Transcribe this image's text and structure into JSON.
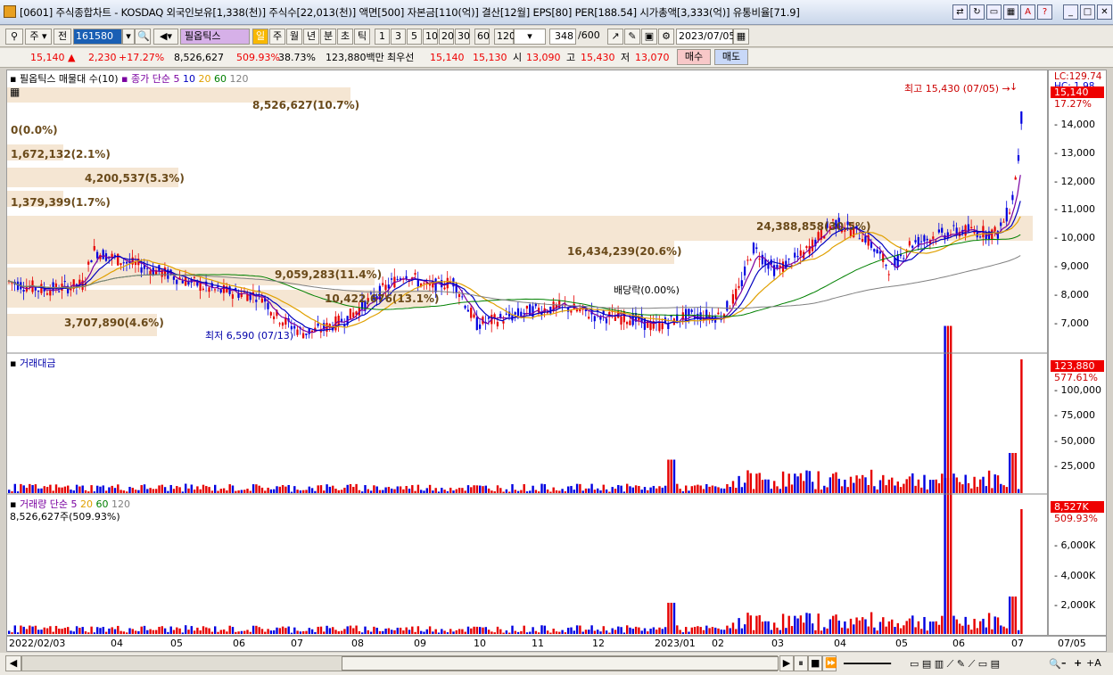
{
  "window": {
    "title": "[0601] 주식종합차트 - KOSDAQ 외국인보유[1,338(천)] 주식수[22,013(천)] 액면[500] 자본금[110(억)] 결산[12월] EPS[80] PER[188.54] 시가총액[3,333(억)] 유통비율[71.9]"
  },
  "toolbar": {
    "market": "주",
    "prev_btn": "전",
    "code": "161580",
    "stock_name": "필옵틱스",
    "periods": [
      "일",
      "주",
      "월",
      "년",
      "분",
      "초",
      "틱"
    ],
    "intervals": [
      "1",
      "3",
      "5",
      "10",
      "20",
      "30",
      "60",
      "120"
    ],
    "count": "348",
    "count_max": "/600",
    "date": "2023/07/05"
  },
  "quote": {
    "price": "15,140",
    "change": "2,230",
    "change_pct": "+17.27%",
    "volume": "8,526,627",
    "volume_ratio": "509.93%",
    "turnover": "38.73%",
    "amount": "123,880백만",
    "best_bid_label": "최우선",
    "best_ask": "15,140",
    "best_bid": "15,130",
    "open_label": "시",
    "open": "13,090",
    "high_label": "고",
    "high": "15,430",
    "low_label": "저",
    "low": "13,070",
    "buy_btn": "매수",
    "sell_btn": "매도"
  },
  "price_panel": {
    "legend_main": "필옵틱스 매물대 수(10)",
    "legend_ma": "종가 단순 5",
    "ma_periods": [
      "10",
      "20",
      "60",
      "120"
    ],
    "max_annot": "최고 15,430 (07/05) →",
    "min_annot": "최저 6,590 (07/13)",
    "dividend_annot": "배당락(0.00%)",
    "lc": "LC:129.74",
    "hc": "HC: 1.98",
    "current_price": "15,140",
    "current_pct": "17.27%",
    "yticks": [
      "14,000",
      "13,000",
      "12,000",
      "11,000",
      "10,000",
      "9,000",
      "8,000",
      "7,000"
    ],
    "volume_profile": [
      {
        "label": "8,526,627(10.7%)"
      },
      {
        "label": "0(0.0%)"
      },
      {
        "label": "1,672,132(2.1%)"
      },
      {
        "label": "4,200,537(5.3%)"
      },
      {
        "label": "1,379,399(1.7%)"
      },
      {
        "label": "24,388,858(30.5%)"
      },
      {
        "label": "16,434,239(20.6%)"
      },
      {
        "label": "9,059,283(11.4%)"
      },
      {
        "label": "10,422,676(13.1%)"
      },
      {
        "label": "3,707,890(4.6%)"
      }
    ]
  },
  "amount_panel": {
    "legend": "거래대금",
    "current": "123,880",
    "current_pct": "577.61%",
    "yticks": [
      "100,000",
      "75,000",
      "50,000",
      "25,000"
    ]
  },
  "volume_panel": {
    "legend": "거래량 단순 5",
    "ma_periods": [
      "20",
      "60",
      "120"
    ],
    "sub": "8,526,627주(509.93%)",
    "current": "8,527K",
    "current_pct": "509.93%",
    "yticks": [
      "6,000K",
      "4,000K",
      "2,000K"
    ]
  },
  "date_axis": [
    "2022/02/03",
    "04",
    "05",
    "06",
    "07",
    "08",
    "09",
    "10",
    "11",
    "12",
    "2023/01",
    "02",
    "03",
    "04",
    "05",
    "06",
    "07",
    "07/05"
  ],
  "colors": {
    "up": "#e60000",
    "down": "#0000e0",
    "profile": "#f5e6d3",
    "ma5": "#7a00a0",
    "ma10": "#0000c0",
    "ma20": "#e0a000",
    "ma60": "#008000",
    "ma120": "#808080"
  },
  "chart_data": {
    "type": "candlestick",
    "x_range": [
      "2022/02/03",
      "2023/07/05"
    ],
    "y_range": [
      6590,
      15430
    ],
    "last_close": 15140,
    "high": 15430,
    "low": 6590
  }
}
